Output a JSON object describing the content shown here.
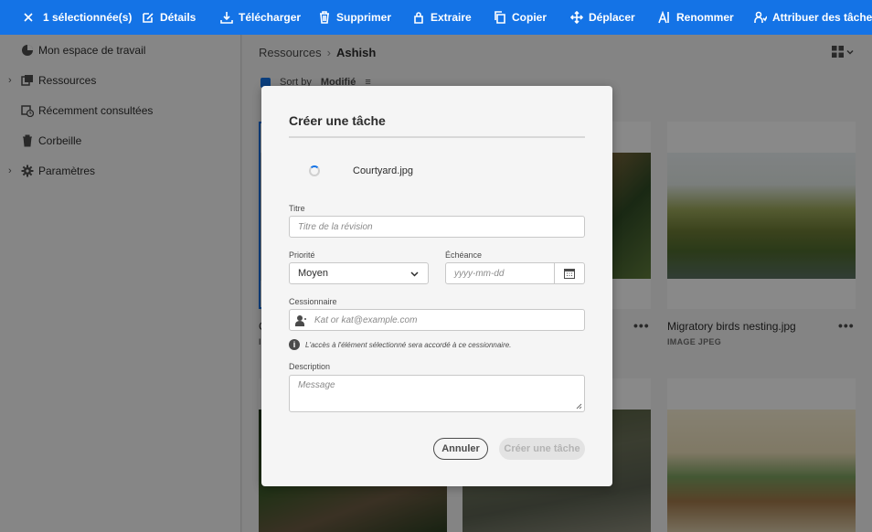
{
  "actionbar": {
    "selected": "1 sélectionnée(s)",
    "details": "Détails",
    "download": "Télécharger",
    "delete": "Supprimer",
    "extract": "Extraire",
    "copy": "Copier",
    "move": "Déplacer",
    "rename": "Renommer",
    "assign_tasks": "Attribuer des tâches",
    "icons": [
      "close-icon",
      "edit-icon",
      "download-icon",
      "trash-icon",
      "lock-icon",
      "copy-icon",
      "move-icon",
      "rename-icon",
      "assign-users-icon"
    ]
  },
  "sidebar": {
    "items": [
      {
        "label": "Mon espace de travail",
        "icon": "workspace-icon"
      },
      {
        "label": "Ressources",
        "icon": "assets-icon"
      },
      {
        "label": "Récemment consultées",
        "icon": "recent-icon"
      },
      {
        "label": "Corbeille",
        "icon": "trash-icon"
      },
      {
        "label": "Paramètres",
        "icon": "gear-icon"
      }
    ]
  },
  "main": {
    "breadcrumb": {
      "parent": "Ressources",
      "separator": "›",
      "current": "Ashish"
    },
    "sort": {
      "label": "Sort by",
      "value": "Modifié"
    },
    "cards": [
      {
        "name": "C",
        "type": "IM"
      },
      {
        "name": "",
        "type": ""
      },
      {
        "name": "Migratory birds nesting.jpg",
        "type": "IMAGE JPEG"
      }
    ]
  },
  "dialog": {
    "title": "Créer une tâche",
    "filename": "Courtyard.jpg",
    "title_label": "Titre",
    "title_placeholder": "Titre de la révision",
    "priority_label": "Priorité",
    "priority_value": "Moyen",
    "due_label": "Échéance",
    "due_placeholder": "yyyy-mm-dd",
    "assignee_label": "Cessionnaire",
    "assignee_placeholder": "Kat or kat@example.com",
    "info_text": "L'accès à l'élément sélectionné sera accordé à ce cessionnaire.",
    "description_label": "Description",
    "description_placeholder": "Message",
    "cancel": "Annuler",
    "create": "Créer une tâche"
  },
  "colors": {
    "accent": "#1473e6",
    "overlay": "rgba(0,0,0,0.45)"
  }
}
